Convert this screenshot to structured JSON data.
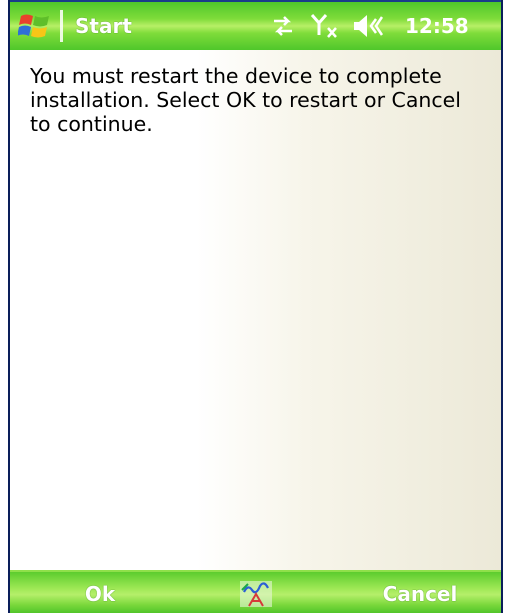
{
  "titlebar": {
    "start_label": "Start",
    "clock": "12:58",
    "icons": [
      "windows-logo-icon",
      "connectivity-icon",
      "signal-off-icon",
      "speaker-icon"
    ]
  },
  "dialog": {
    "message": "You must restart the device to complete installation. Select OK to restart or Cancel to continue."
  },
  "softkeys": {
    "left_label": "Ok",
    "right_label": "Cancel",
    "center_icon": "input-panel-icon"
  },
  "colors": {
    "bar_green": "#7fdc3a",
    "frame_blue": "#0a1e5a",
    "text": "#000000"
  }
}
